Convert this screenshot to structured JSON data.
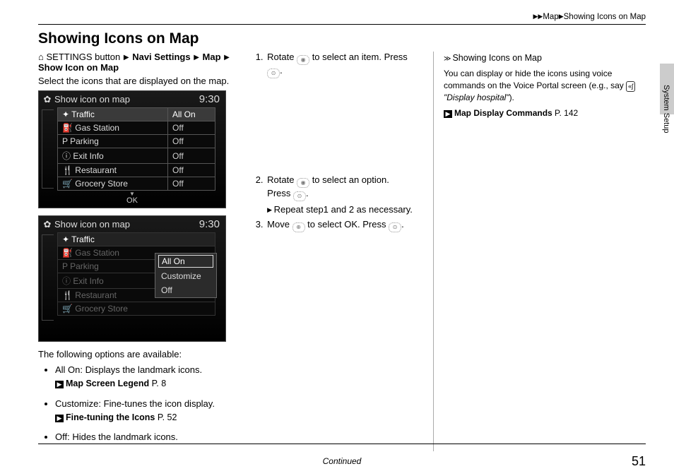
{
  "breadcrumb": {
    "item1": "Map",
    "item2": "Showing Icons on Map"
  },
  "title": "Showing Icons on Map",
  "navpath": {
    "prefix": "SETTINGS button",
    "s1": "Navi Settings",
    "s2": "Map",
    "s3": "Show Icon on Map"
  },
  "intro": "Select the icons that are displayed on the map.",
  "screenshot1": {
    "title": "Show icon on map",
    "clock": "9:30",
    "rows": [
      {
        "label": "Traffic",
        "value": "All On"
      },
      {
        "label": "Gas Station",
        "value": "Off"
      },
      {
        "label": "Parking",
        "value": "Off"
      },
      {
        "label": "Exit Info",
        "value": "Off"
      },
      {
        "label": "Restaurant",
        "value": "Off"
      },
      {
        "label": "Grocery Store",
        "value": "Off"
      }
    ],
    "ok": "OK"
  },
  "screenshot2": {
    "title": "Show icon on map",
    "clock": "9:30",
    "rows": [
      {
        "label": "Traffic"
      },
      {
        "label": "Gas Station"
      },
      {
        "label": "Parking"
      },
      {
        "label": "Exit Info"
      },
      {
        "label": "Restaurant"
      },
      {
        "label": "Grocery Store"
      }
    ],
    "popup": [
      "All On",
      "Customize",
      "Off"
    ]
  },
  "steps": {
    "s1a": "Rotate ",
    "s1b": " to select an item. Press ",
    "s1c": ".",
    "s2a": "Rotate ",
    "s2b": " to select an option. Press ",
    "s2c": ".",
    "s2sub": "Repeat step1 and 2 as necessary.",
    "s3a": "Move ",
    "s3b": " to select ",
    "s3ok": "OK",
    "s3c": ". Press ",
    "s3d": "."
  },
  "options_intro": "The following options are available:",
  "options": [
    {
      "name": "All On",
      "desc": ": Displays the landmark icons.",
      "ref": "Map Screen Legend",
      "page": "P. 8"
    },
    {
      "name": "Customize",
      "desc": ": Fine-tunes the icon display.",
      "ref": "Fine-tuning the Icons",
      "page": "P. 52"
    },
    {
      "name": "Off",
      "desc": ": Hides the landmark icons."
    }
  ],
  "sidebar": {
    "header": "Showing Icons on Map",
    "text1": "You can display or hide the icons using voice commands on the Voice Portal screen (e.g., say ",
    "voice": "\"Display hospital\"",
    "text2": ").",
    "ref": "Map Display Commands",
    "refpage": "P. 142",
    "tab": "System Setup"
  },
  "footer": {
    "continued": "Continued",
    "page": "51"
  }
}
